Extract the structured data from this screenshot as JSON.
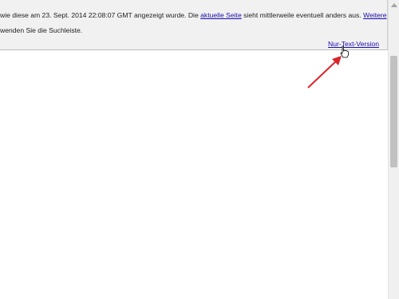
{
  "cache_header": {
    "line1_prefix": "wie diese am 23. Sept. 2014 22:08:07 GMT angezeigt wurde. Die ",
    "current_page_link": "aktuelle Seite",
    "line1_middle": " sieht mittlerweile eventuell anders aus. ",
    "more_link": "Weitere",
    "line2_text": "wenden Sie die Suchleiste.",
    "text_only_link": "Nur-Text-Version"
  },
  "colors": {
    "link": "#1a0dab",
    "header_bg": "#f1f1f1",
    "arrow": "#d9262b"
  }
}
